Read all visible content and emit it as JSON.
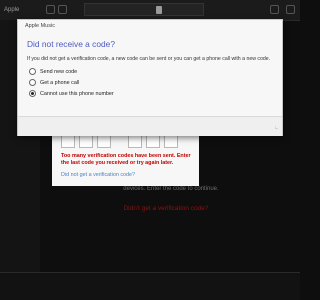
{
  "app": {
    "label": "Apple"
  },
  "dialog": {
    "title": "Apple Music",
    "heading": "Did not receive a code?",
    "description": "If you did not get a verification code, a new code can be sent or you can get a phone call with a new code.",
    "options": [
      {
        "label": "Send new code",
        "checked": false
      },
      {
        "label": "Get a phone call",
        "checked": false
      },
      {
        "label": "Cannot use this phone number",
        "checked": true
      }
    ]
  },
  "code_sheet": {
    "error_text": "Too many verification codes have been sent. Enter the last code you received or try again later.",
    "link_text": "Did not get a verification code?"
  },
  "background": {
    "devices_text": "devices. Enter the code to continue.",
    "red_link": "Didn't get a verification code?"
  },
  "colors": {
    "heading": "#4d5cc1",
    "error": "#c40000",
    "link": "#4b82c9"
  }
}
